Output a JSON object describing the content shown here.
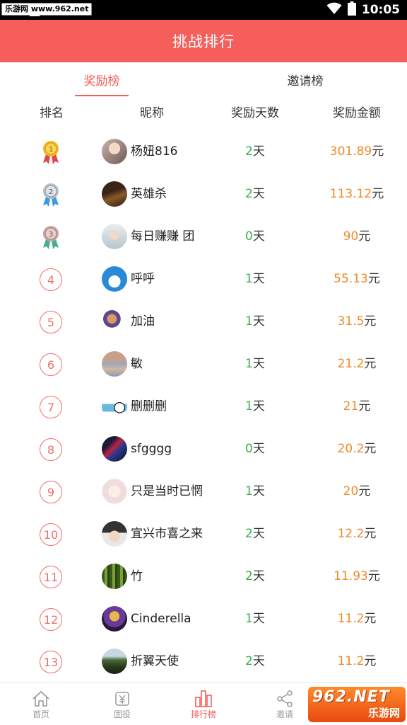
{
  "status_bar": {
    "watermark": "乐游网 www.962.net",
    "time": "10:05"
  },
  "header": {
    "title": "挑战排行"
  },
  "tabs": [
    {
      "label": "奖励榜"
    },
    {
      "label": "邀请榜"
    }
  ],
  "columns": {
    "rank": "排名",
    "nickname": "昵称",
    "days": "奖励天数",
    "amount": "奖励金额"
  },
  "units": {
    "days": "天",
    "yuan": "元"
  },
  "rows": [
    {
      "rank": "1",
      "nickname": "杨妞816",
      "days": "2",
      "amount": "301.89"
    },
    {
      "rank": "2",
      "nickname": "英雄杀",
      "days": "2",
      "amount": "113.12"
    },
    {
      "rank": "3",
      "nickname": "每日赚赚 团",
      "days": "0",
      "amount": "90"
    },
    {
      "rank": "4",
      "nickname": "呼呼",
      "days": "1",
      "amount": "55.13"
    },
    {
      "rank": "5",
      "nickname": "加油",
      "days": "1",
      "amount": "31.5"
    },
    {
      "rank": "6",
      "nickname": "敏",
      "days": "1",
      "amount": "21.2"
    },
    {
      "rank": "7",
      "nickname": "删删删",
      "days": "1",
      "amount": "21"
    },
    {
      "rank": "8",
      "nickname": "sfgggg",
      "days": "0",
      "amount": "20.2"
    },
    {
      "rank": "9",
      "nickname": "只是当时已惘",
      "days": "1",
      "amount": "20"
    },
    {
      "rank": "10",
      "nickname": "宜兴市喜之来",
      "days": "2",
      "amount": "12.2"
    },
    {
      "rank": "11",
      "nickname": "竹",
      "days": "2",
      "amount": "11.93"
    },
    {
      "rank": "12",
      "nickname": "Cinderella",
      "days": "1",
      "amount": "11.2"
    },
    {
      "rank": "13",
      "nickname": "折翼天使",
      "days": "2",
      "amount": "11.2"
    }
  ],
  "bottom_nav": [
    {
      "label": "首页",
      "icon": "home-icon"
    },
    {
      "label": "固投",
      "icon": "yen-icon"
    },
    {
      "label": "排行榜",
      "icon": "bar-chart-icon"
    },
    {
      "label": "邀请",
      "icon": "share-icon"
    }
  ],
  "watermark": {
    "logo": "962.NET",
    "text": "乐游网"
  },
  "colors": {
    "brand": "#f55e5a",
    "days_number": "#37b04a",
    "amount_number": "#ef8a28",
    "rank_circle": "#f06e6a",
    "nav_inactive": "#999999"
  }
}
